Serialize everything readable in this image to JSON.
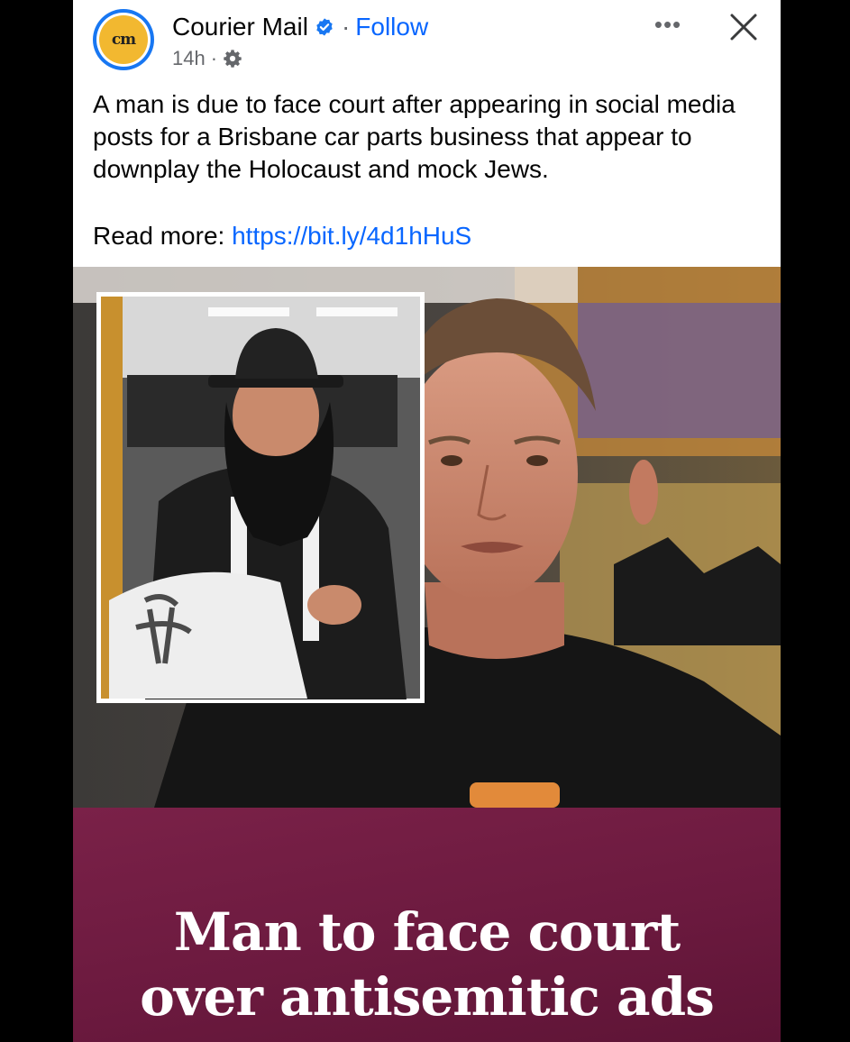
{
  "post": {
    "page_name": "Courier Mail",
    "avatar_text": "cm",
    "follow_label": "Follow",
    "separator": "·",
    "timestamp": "14h",
    "more_label": "•••",
    "text": "A man is due to face court after appearing in social media posts for a Brisbane car parts business that appear to downplay the Holocaust and mock Jews.",
    "read_more_label": "Read more:",
    "link": "https://bit.ly/4d1hHuS"
  },
  "media": {
    "headline_line1": "Man to face court",
    "headline_line2": "over antisemitic ads"
  },
  "colors": {
    "link": "#0866ff",
    "verified": "#1877f2",
    "banner": "#6c1a3f",
    "avatar_ring": "#1877f2",
    "avatar_fill": "#f2b830"
  }
}
